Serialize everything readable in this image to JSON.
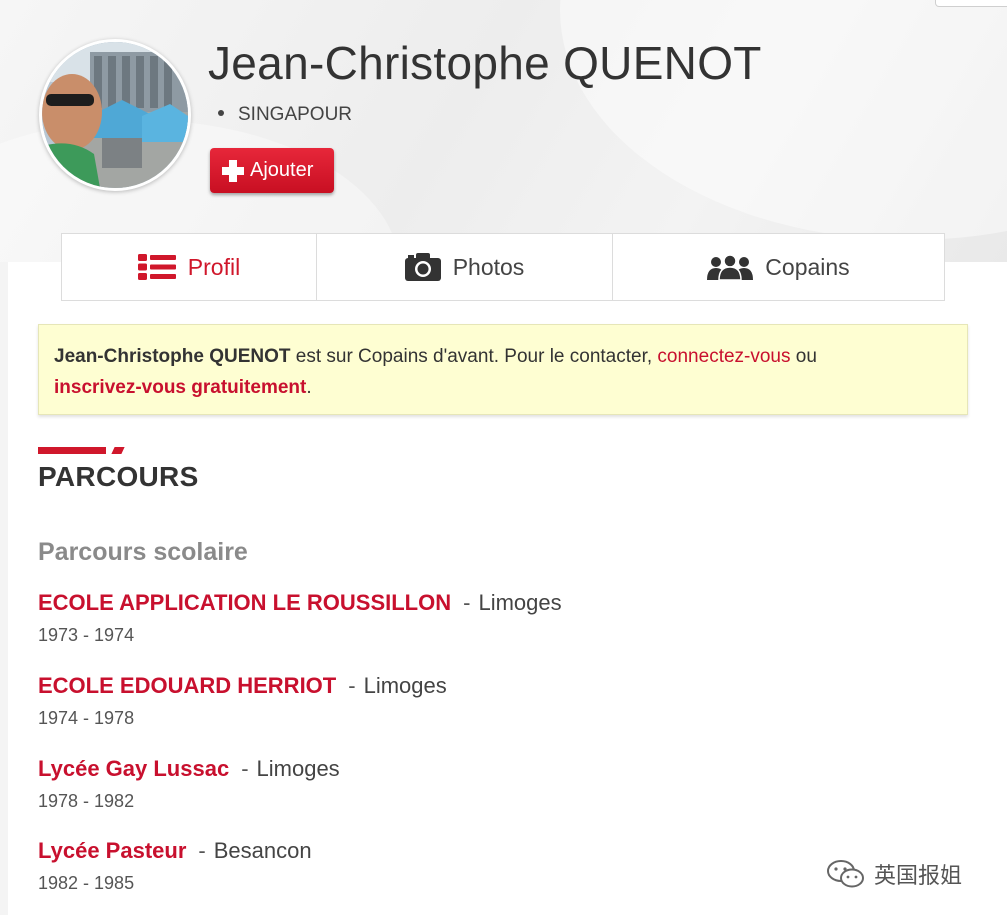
{
  "profile": {
    "name": "Jean-Christophe QUENOT",
    "location": "SINGAPOUR",
    "add_label": "Ajouter"
  },
  "tabs": [
    {
      "label": "Profil",
      "icon": "list-icon",
      "active": true
    },
    {
      "label": "Photos",
      "icon": "camera-icon",
      "active": false
    },
    {
      "label": "Copains",
      "icon": "group-icon",
      "active": false
    }
  ],
  "notice": {
    "name": "Jean-Christophe QUENOT",
    "text1": " est sur Copains d'avant. Pour le contacter, ",
    "link1": "connectez-vous",
    "text2": " ou ",
    "link2": "inscrivez-vous gratuitement",
    "text3": "."
  },
  "section": {
    "title": "PARCOURS",
    "subtitle": "Parcours scolaire"
  },
  "schools": [
    {
      "name": "ECOLE APPLICATION LE ROUSSILLON",
      "separator": "-",
      "city": "Limoges",
      "years": "1973 - 1974"
    },
    {
      "name": "ECOLE EDOUARD HERRIOT",
      "separator": "-",
      "city": "Limoges",
      "years": "1974 - 1978"
    },
    {
      "name": "Lycée Gay Lussac",
      "separator": "-",
      "city": "Limoges",
      "years": "1978 - 1982"
    },
    {
      "name": "Lycée Pasteur",
      "separator": "-",
      "city": "Besancon",
      "years": "1982 - 1985"
    }
  ],
  "watermark": {
    "text": "英国报姐",
    "icon": "wechat-icon"
  },
  "colors": {
    "accent": "#d0172b",
    "link": "#c8102e",
    "notice_bg": "#fefed2"
  }
}
